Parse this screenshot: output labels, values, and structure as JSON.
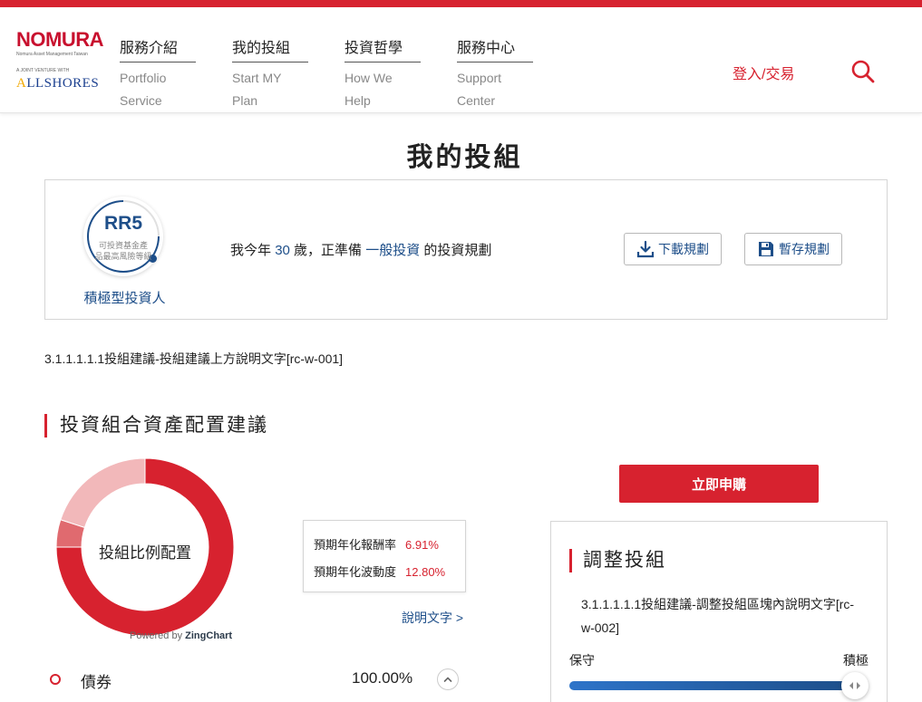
{
  "brand": {
    "logo_text": "NOMURA",
    "logo_subtitle": "Nomura Asset Management Taiwan",
    "joint_venture": "A JOINT VENTURE WITH",
    "partner_prefix": "A",
    "partner_rest": "LLSHORES"
  },
  "nav": [
    {
      "zh": "服務介紹",
      "en1": "Portfolio",
      "en2": "Service"
    },
    {
      "zh": "我的投組",
      "en1": "Start MY",
      "en2": "Plan"
    },
    {
      "zh": "投資哲學",
      "en1": "How We",
      "en2": "Help"
    },
    {
      "zh": "服務中心",
      "en1": "Support",
      "en2": "Center"
    }
  ],
  "header": {
    "login_label": "登入/交易",
    "search_icon": "search-icon"
  },
  "page_title": "我的投組",
  "profile": {
    "risk_code": "RR5",
    "risk_desc_line1": "可投資基金產",
    "risk_desc_line2": "品最高風險等級",
    "risk_level": 1.0,
    "investor_type": "積極型投資人",
    "sentence_part1": "我今年",
    "age": "30",
    "sentence_part2": "歲，正準備",
    "goal": "一般投資",
    "sentence_part3": "的投資規劃",
    "download_label": "下載規劃",
    "save_label": "暫存規劃"
  },
  "desc_top": "3.1.1.1.1.1投組建議-投組建議上方說明文字[rc-w-001]",
  "section_title": "投資組合資產配置建議",
  "chart_data": {
    "type": "pie",
    "center_label": "投組比例配置",
    "attribution": "Powered by",
    "attribution_brand": "ZingChart",
    "slices": [
      {
        "value": 75,
        "color": "#d7222f"
      },
      {
        "value": 5,
        "color": "#e06a6f"
      },
      {
        "value": 20,
        "color": "#f2b8ba"
      }
    ]
  },
  "stats": {
    "return_label": "預期年化報酬率",
    "return_value": "6.91%",
    "vol_label": "預期年化波動度",
    "vol_value": "12.80%",
    "link_label": "說明文字 >"
  },
  "legend": [
    {
      "name": "債券",
      "pct": "100.00%"
    }
  ],
  "subscribe_label": "立即申購",
  "adjust": {
    "title": "調整投組",
    "desc": "3.1.1.1.1.1投組建議-調整投組區塊內說明文字[rc-w-002]",
    "min_label": "保守",
    "max_label": "積極",
    "level": 1.0
  },
  "colors": {
    "accent": "#d7222f",
    "brand_blue": "#1d4e89"
  }
}
